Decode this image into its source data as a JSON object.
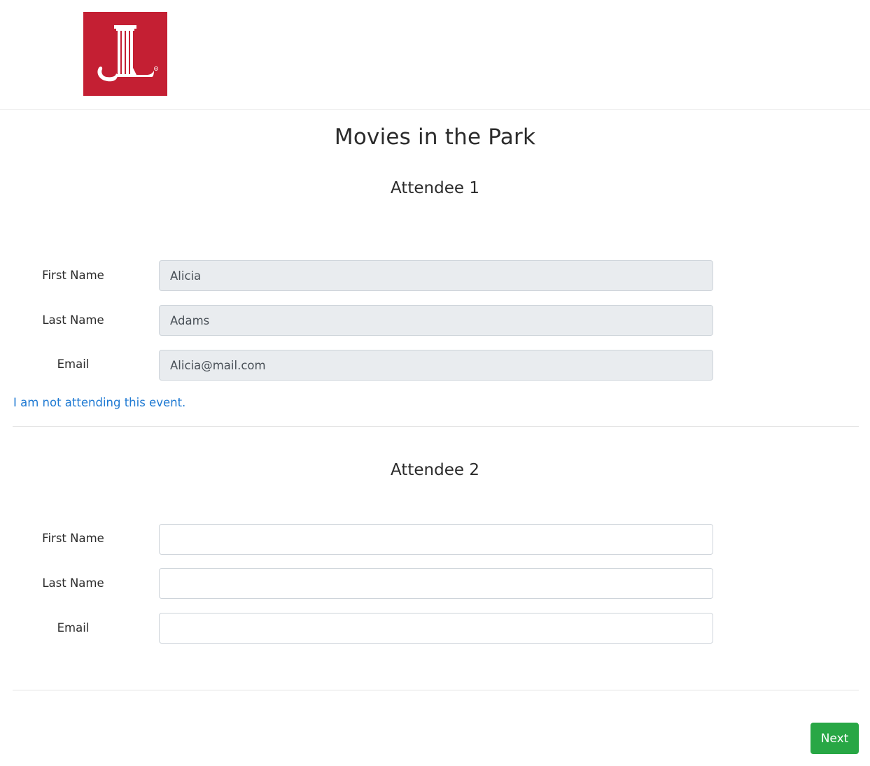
{
  "event": {
    "title": "Movies in the Park"
  },
  "brand": {
    "logo_icon": "junior-league-logo-icon",
    "logo_color": "#c41f33"
  },
  "attendees": [
    {
      "heading": "Attendee 1",
      "first_name_label": "First Name",
      "first_name_value": "Alicia",
      "last_name_label": "Last Name",
      "last_name_value": "Adams",
      "email_label": "Email",
      "email_value": "Alicia@mail.com",
      "not_attending_link": "I am not attending this event."
    },
    {
      "heading": "Attendee 2",
      "first_name_label": "First Name",
      "first_name_value": "",
      "last_name_label": "Last Name",
      "last_name_value": "",
      "email_label": "Email",
      "email_value": ""
    }
  ],
  "actions": {
    "next_label": "Next",
    "next_color": "#28a745",
    "link_color": "#1f7ad3"
  }
}
